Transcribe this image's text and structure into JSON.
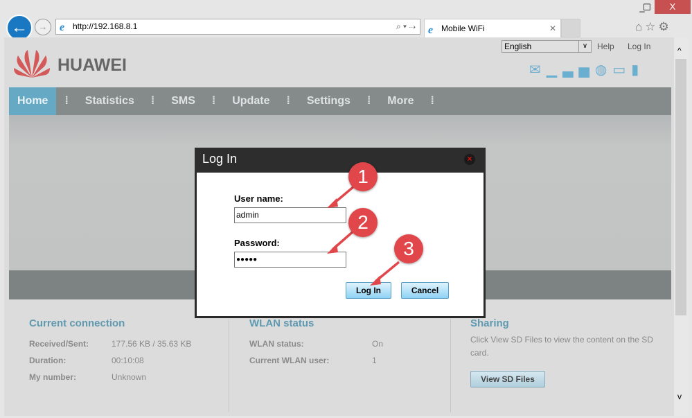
{
  "browser": {
    "url": "http://192.168.8.1",
    "tab_title": "Mobile WiFi",
    "minimize": "_",
    "maximize": "☐",
    "close": "X"
  },
  "header": {
    "brand": "HUAWEI",
    "language": "English",
    "help": "Help",
    "login": "Log In"
  },
  "nav": [
    {
      "label": "Home",
      "active": true
    },
    {
      "label": "Statistics"
    },
    {
      "label": "SMS"
    },
    {
      "label": "Update"
    },
    {
      "label": "Settings"
    },
    {
      "label": "More"
    }
  ],
  "current_connection": {
    "title": "Current connection",
    "rows": [
      {
        "k": "Received/Sent:",
        "v": "177.56 KB /  35.63 KB"
      },
      {
        "k": "Duration:",
        "v": "00:10:08"
      },
      {
        "k": "My number:",
        "v": "Unknown"
      }
    ]
  },
  "wlan": {
    "title": "WLAN status",
    "rows": [
      {
        "k": "WLAN status:",
        "v": "On"
      },
      {
        "k": "Current WLAN user:",
        "v": "1"
      }
    ]
  },
  "sharing": {
    "title": "Sharing",
    "text": "Click View SD Files to view the content on the SD card.",
    "button": "View SD Files"
  },
  "dialog": {
    "title": "Log In",
    "username_label": "User name:",
    "username_value": "admin",
    "password_label": "Password:",
    "password_value": "●●●●●",
    "login_button": "Log In",
    "cancel_button": "Cancel"
  },
  "annotations": [
    "1",
    "2",
    "3"
  ],
  "colors": {
    "accent": "#65a9c4",
    "badge": "#e0464a",
    "nav": "#858a8b"
  }
}
